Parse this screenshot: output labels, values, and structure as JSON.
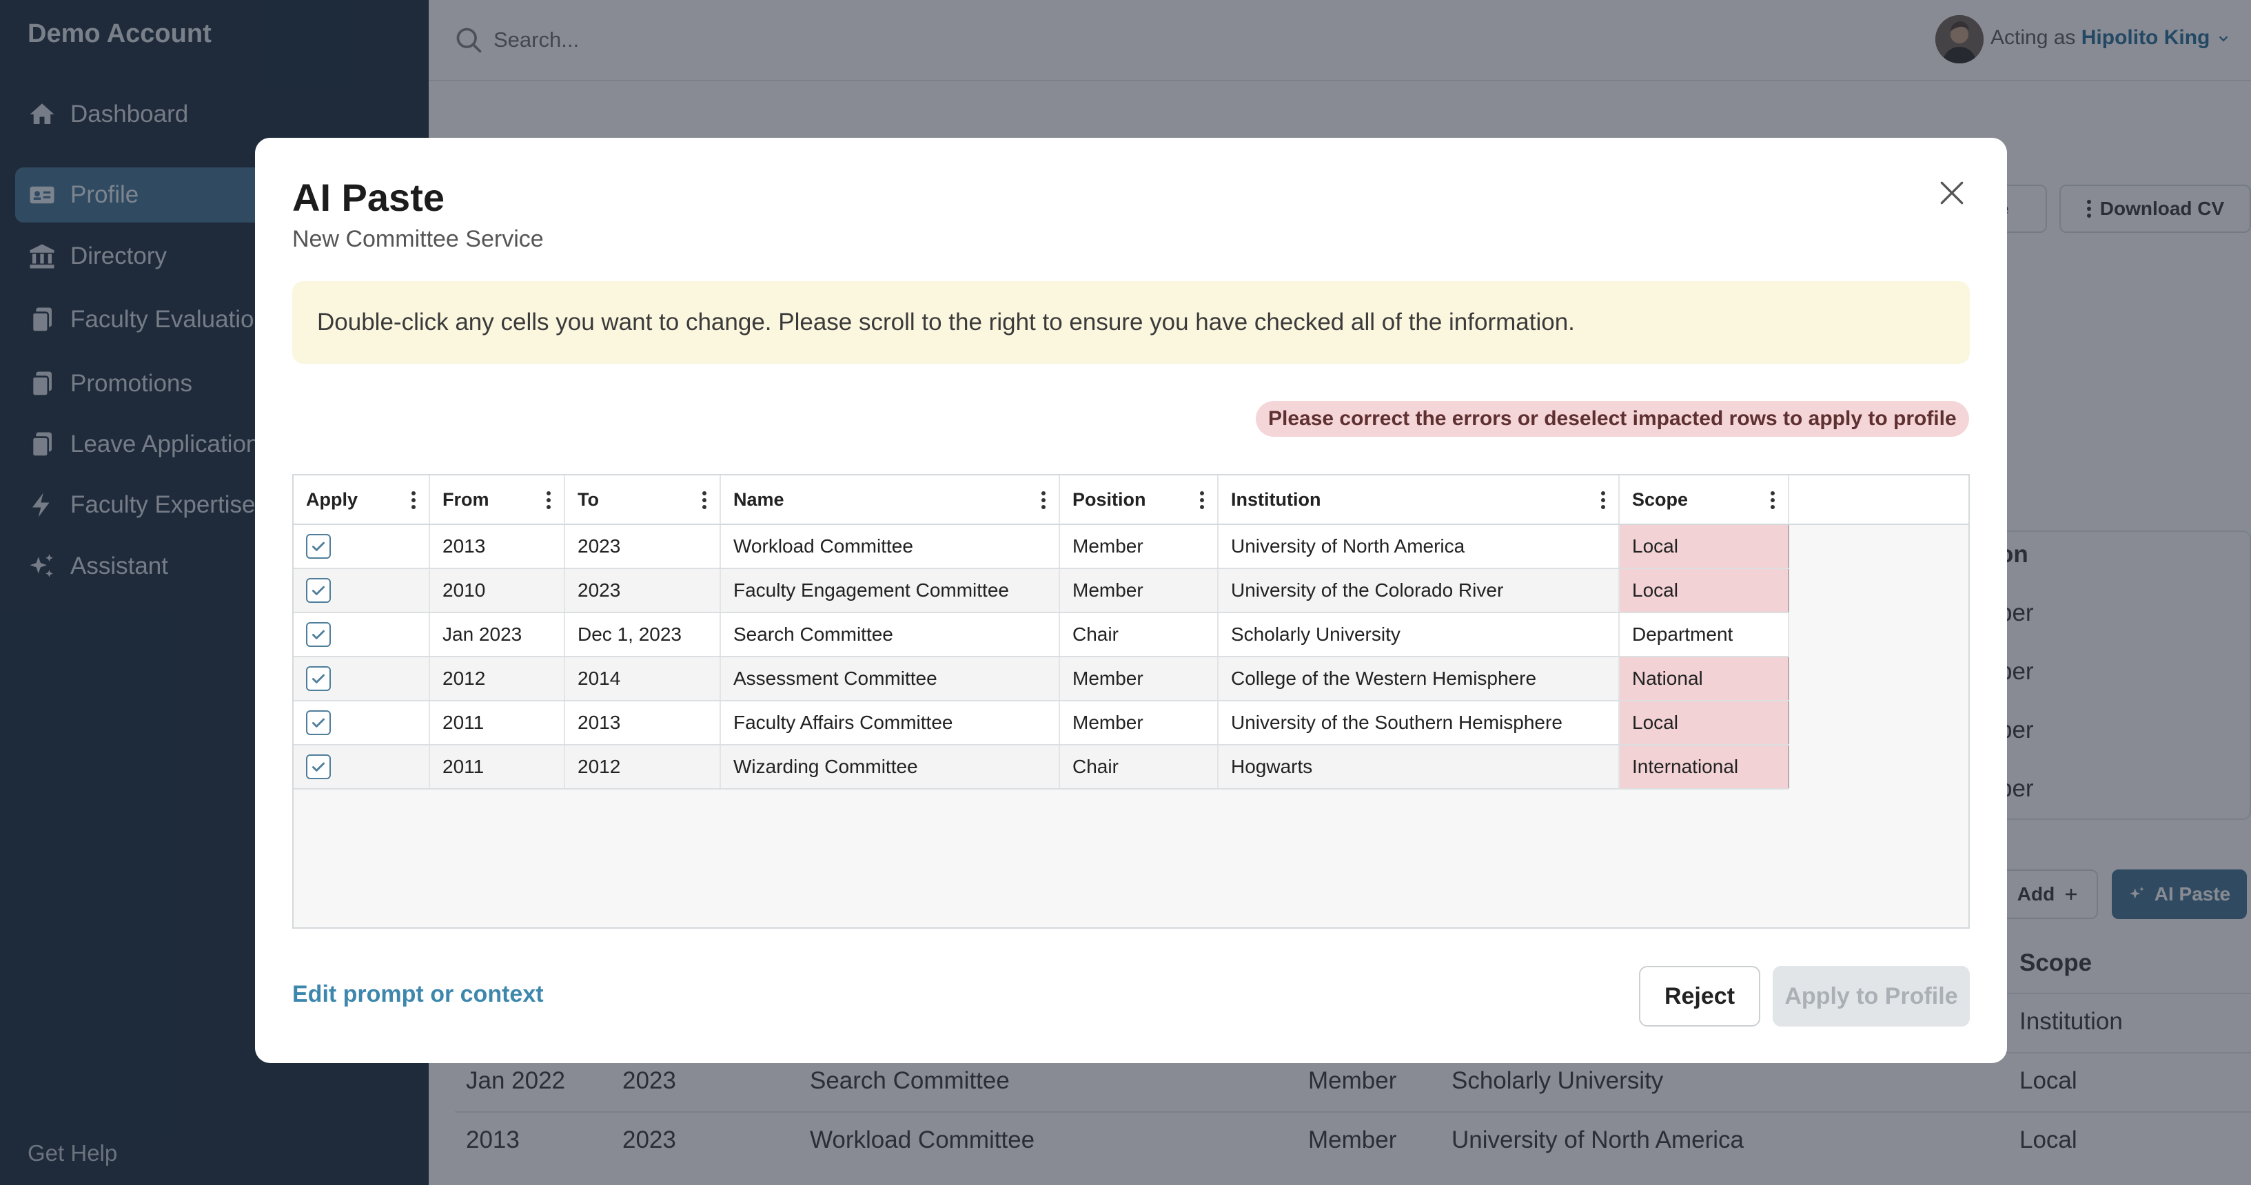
{
  "sidebar": {
    "brand": "Demo Account",
    "items": [
      {
        "label": "Dashboard",
        "icon": "home-icon"
      },
      {
        "label": "Profile",
        "icon": "id-card-icon",
        "active": true
      },
      {
        "label": "Directory",
        "icon": "building-icon"
      },
      {
        "label": "Faculty Evaluations",
        "icon": "documents-icon"
      },
      {
        "label": "Promotions",
        "icon": "documents-icon"
      },
      {
        "label": "Leave Applications",
        "icon": "documents-icon"
      },
      {
        "label": "Faculty Expertise",
        "icon": "bolt-icon"
      },
      {
        "label": "Assistant",
        "icon": "sparkles-icon"
      }
    ],
    "help": "Get Help"
  },
  "topbar": {
    "search_placeholder": "Search...",
    "acting_prefix": "Acting as",
    "acting_user": "Hipolito King"
  },
  "background": {
    "expertise_btn": "ise",
    "download_cv": "Download CV",
    "table1_header_partial": "on",
    "table1_cells_partial": [
      "ber",
      "ber",
      "ber",
      "ber"
    ],
    "add_btn": "Add",
    "ai_paste_btn": "AI Paste",
    "scope_header": "Scope",
    "rows": [
      {
        "from": "",
        "to": "",
        "name": "",
        "position": "",
        "institution": "",
        "scope": "Institution"
      },
      {
        "from": "Jan 2022",
        "to": "2023",
        "name": "Search Committee",
        "position": "Member",
        "institution": "Scholarly University",
        "scope": "Local"
      },
      {
        "from": "2013",
        "to": "2023",
        "name": "Workload Committee",
        "position": "Member",
        "institution": "University of North America",
        "scope": "Local"
      }
    ]
  },
  "modal": {
    "title": "AI Paste",
    "subtitle": "New Committee Service",
    "notice": "Double-click any cells you want to change. Please scroll to the right to ensure you have checked all of the information.",
    "error": "Please correct the errors or deselect impacted rows to apply to profile",
    "columns": [
      "Apply",
      "From",
      "To",
      "Name",
      "Position",
      "Institution",
      "Scope"
    ],
    "rows": [
      {
        "from": "2013",
        "to": "2023",
        "name": "Workload Committee",
        "position": "Member",
        "institution": "University of North America",
        "scope": "Local",
        "scope_error": true
      },
      {
        "from": "2010",
        "to": "2023",
        "name": "Faculty Engagement Committee",
        "position": "Member",
        "institution": "University of the Colorado River",
        "scope": "Local",
        "scope_error": true
      },
      {
        "from": "Jan 2023",
        "to": "Dec 1, 2023",
        "name": "Search Committee",
        "position": "Chair",
        "institution": "Scholarly University",
        "scope": "Department",
        "scope_error": false
      },
      {
        "from": "2012",
        "to": "2014",
        "name": "Assessment Committee",
        "position": "Member",
        "institution": "College of the Western Hemisphere",
        "scope": "National",
        "scope_error": true
      },
      {
        "from": "2011",
        "to": "2013",
        "name": "Faculty Affairs Committee",
        "position": "Member",
        "institution": "University of the Southern Hemisphere",
        "scope": "Local",
        "scope_error": true
      },
      {
        "from": "2011",
        "to": "2012",
        "name": "Wizarding Committee",
        "position": "Chair",
        "institution": "Hogwarts",
        "scope": "International",
        "scope_error": true
      }
    ],
    "edit_link": "Edit prompt or context",
    "reject": "Reject",
    "apply": "Apply to Profile"
  },
  "colors": {
    "accent": "#4e7e9a",
    "error_bg": "#f2d2d4",
    "notice_bg": "#fbf6de",
    "sidebar_bg": "#2c3e4d"
  }
}
